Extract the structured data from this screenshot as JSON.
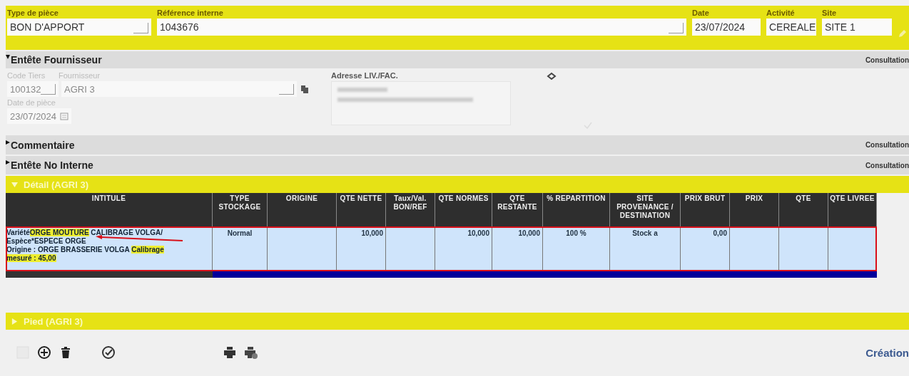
{
  "top_fields": [
    {
      "label": "Type de pièce",
      "value": "BON D'APPORT",
      "picker": true
    },
    {
      "label": "Référence interne",
      "value": "1043676",
      "picker": true
    },
    {
      "label": "Date",
      "value": "23/07/2024",
      "picker": false
    },
    {
      "label": "Activité",
      "value": "CEREALE",
      "picker": false
    },
    {
      "label": "Site",
      "value": "SITE 1",
      "picker": false
    }
  ],
  "sections": [
    {
      "title": "Entête Fournisseur",
      "expanded": true,
      "mode": "Consultation"
    },
    {
      "title": "Commentaire",
      "expanded": false,
      "mode": "Consultation"
    },
    {
      "title": "Entête No Interne",
      "expanded": false,
      "mode": "Consultation"
    }
  ],
  "supplier": {
    "code_label": "Code Tiers",
    "code": "100132",
    "supplier_label": "Fournisseur",
    "supplier": "AGRI 3",
    "date_label": "Date de pièce",
    "date": "23/07/2024",
    "address_label": "Adresse LIV./FAC."
  },
  "detail": {
    "title": "Détail (AGRI 3)",
    "expanded": true,
    "columns": [
      "INTITULE",
      "TYPE STOCKAGE",
      "ORIGINE",
      "QTE NETTE",
      "Taux/Val. BON/REF",
      "QTE NORMES",
      "QTE RESTANTE",
      "% REPARTITION",
      "SITE PROVENANCE / DESTINATION",
      "PRIX BRUT",
      "PRIX",
      "QTE",
      "QTE LIVREE"
    ],
    "rows": [
      {
        "selected": true,
        "cells": [
          {
            "lines": [
              [
                {
                  "text": "Variété",
                  "highlighted": false
                },
                {
                  "text": "ORGE MOUTURE",
                  "highlighted": true
                },
                {
                  "text": " CALIBRAGE VOLGA/",
                  "highlighted": false
                }
              ],
              [
                {
                  "text": "Espèce*ESPECE ORGE",
                  "highlighted": false
                }
              ],
              [
                {
                  "text": "Origine :  ORGE BRASSERIE VOLGA ",
                  "highlighted": false
                },
                {
                  "text": "Calibrage",
                  "highlighted": true
                }
              ],
              [
                {
                  "text": "mesuré :  45,00",
                  "highlighted": true
                }
              ]
            ]
          },
          "Normal",
          "",
          "10,000",
          "",
          "10,000",
          "10,000",
          "100 %",
          "Stock a",
          "0,00",
          "",
          "",
          ""
        ]
      }
    ]
  },
  "footer": {
    "title": "Pied (AGRI 3)",
    "expanded": false
  },
  "status": "Création"
}
